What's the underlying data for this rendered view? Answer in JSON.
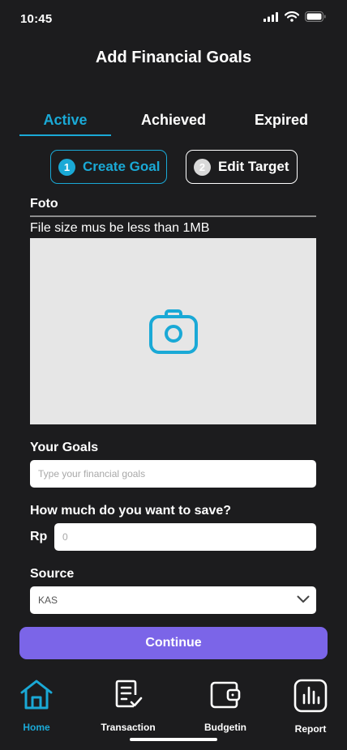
{
  "status_bar": {
    "time": "10:45"
  },
  "header": {
    "title": "Add Financial Goals"
  },
  "tabs": [
    {
      "label": "Active",
      "active": true
    },
    {
      "label": "Achieved",
      "active": false
    },
    {
      "label": "Expired",
      "active": false
    }
  ],
  "steps": [
    {
      "number": "1",
      "label": "Create Goal",
      "active": true
    },
    {
      "number": "2",
      "label": "Edit Target",
      "active": false
    }
  ],
  "form": {
    "foto_label": "Foto",
    "file_note": "File size mus be less than 1MB",
    "photo_icon": "camera-icon",
    "goals_label": "Your Goals",
    "goals_placeholder": "Type your financial goals",
    "save_label": "How much do you want to save?",
    "currency": "Rp",
    "amount_placeholder": "0",
    "source_label": "Source",
    "source_value": "KAS"
  },
  "continue_label": "Continue",
  "bottom_nav": [
    {
      "label": "Home",
      "icon": "home-icon",
      "active": true
    },
    {
      "label": "Transaction",
      "icon": "transaction-icon",
      "active": false
    },
    {
      "label": "Budgetin",
      "icon": "wallet-icon",
      "active": false
    },
    {
      "label": "Report",
      "icon": "report-icon",
      "active": false
    }
  ],
  "colors": {
    "accent": "#1aa9d6",
    "primary_button": "#7b65e8",
    "background": "#1c1c1e"
  }
}
